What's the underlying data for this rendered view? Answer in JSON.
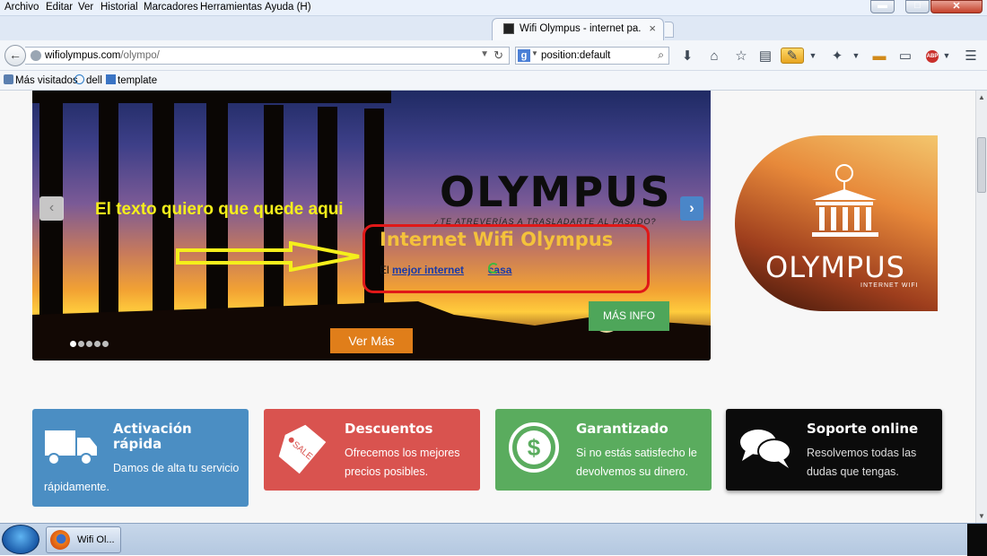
{
  "menubar": {
    "items": [
      "Archivo",
      "Editar",
      "Ver",
      "Historial",
      "Marcadores",
      "Herramientas",
      "Ayuda (H)"
    ]
  },
  "window_buttons": {
    "minimize": "▬",
    "maximize": "□",
    "close": "✕"
  },
  "tab": {
    "title": "Wifi Olympus - internet pa...",
    "close": "×"
  },
  "navbar": {
    "url_host": "wifiolympus.com",
    "url_path": "/olympo/",
    "search_engine": "g",
    "search_query": "position:default"
  },
  "bookmarks": [
    {
      "label": "Más visitados",
      "icon": "folder-icon"
    },
    {
      "label": "dell",
      "icon": "dell-icon"
    },
    {
      "label": "template",
      "icon": "page-icon"
    }
  ],
  "hero": {
    "brand": "OLYMPUS",
    "brand_tagline": "¿TE ATREVERÍAS A TRASLADARTE AL PASADO?",
    "annotation": "El texto quiero que quede aqui",
    "slide_title": "Internet Wifi Olympus",
    "slide_desc_prefix": "El ",
    "slide_desc_link1": "mejor internet",
    "slide_desc_mid": " ",
    "slide_desc_link2": "casa",
    "more_info": "MÁS INFO",
    "see_more": "Ver Más",
    "prev_arrow": "‹",
    "next_arrow": "›",
    "dots_count": 5,
    "active_dot": 0
  },
  "logo": {
    "word": "OLYMPUS",
    "sub": "INTERNET WIFI"
  },
  "features": [
    {
      "title": "Activación rápida",
      "title_line1": "Activación",
      "title_line2": "rápida",
      "desc_line1": "Damos de alta tu servicio",
      "desc_line2": "rápidamente.",
      "color": "#4b8ec3",
      "icon": "truck-icon"
    },
    {
      "title": "Descuentos",
      "desc_line1": "Ofrecemos los mejores",
      "desc_line2": "precios posibles.",
      "color": "#d9534f",
      "icon": "sale-tag-icon",
      "icon_text": "SALE"
    },
    {
      "title": "Garantizado",
      "desc_line1": "Si no estás satisfecho le",
      "desc_line2": "devolvemos su dinero.",
      "color": "#5aac5e",
      "icon": "dollar-icon",
      "icon_text": "$"
    },
    {
      "title": "Soporte online",
      "desc_line1": "Resolvemos todas las",
      "desc_line2": "dudas que tengas.",
      "color": "#0b0b0b",
      "icon": "chat-bubbles-icon"
    }
  ],
  "taskbar": {
    "firefox_label": "Wifi Ol..."
  }
}
